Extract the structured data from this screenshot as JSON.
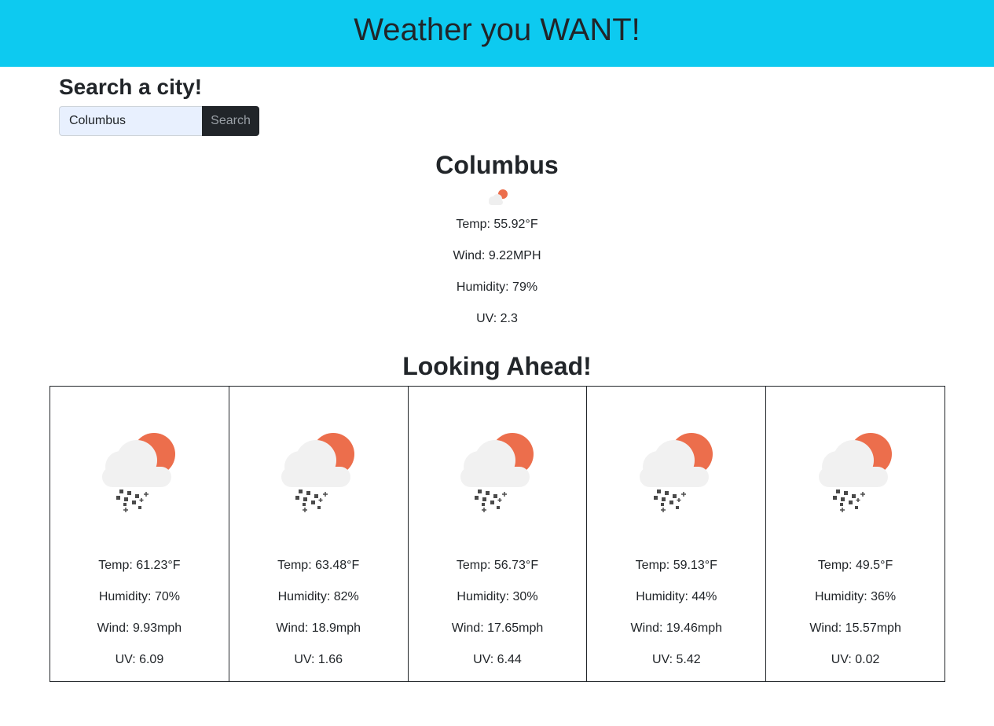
{
  "header": {
    "title": "Weather you WANT!"
  },
  "search": {
    "heading": "Search a city!",
    "input_value": "Columbus",
    "button_label": "Search"
  },
  "current": {
    "city": "Columbus",
    "icon": "cloud-sun-icon",
    "temp": "Temp: 55.92°F",
    "wind": "Wind: 9.22MPH",
    "humidity": "Humidity: 79%",
    "uv": "UV: 2.3"
  },
  "forecast": {
    "heading": "Looking Ahead!",
    "days": [
      {
        "icon": "sleet-icon",
        "temp": "Temp: 61.23°F",
        "humidity": "Humidity: 70%",
        "wind": "Wind: 9.93mph",
        "uv": "UV: 6.09"
      },
      {
        "icon": "sleet-icon",
        "temp": "Temp: 63.48°F",
        "humidity": "Humidity: 82%",
        "wind": "Wind: 18.9mph",
        "uv": "UV: 1.66"
      },
      {
        "icon": "sleet-icon",
        "temp": "Temp: 56.73°F",
        "humidity": "Humidity: 30%",
        "wind": "Wind: 17.65mph",
        "uv": "UV: 6.44"
      },
      {
        "icon": "sleet-icon",
        "temp": "Temp: 59.13°F",
        "humidity": "Humidity: 44%",
        "wind": "Wind: 19.46mph",
        "uv": "UV: 5.42"
      },
      {
        "icon": "sleet-icon",
        "temp": "Temp: 49.5°F",
        "humidity": "Humidity: 36%",
        "wind": "Wind: 15.57mph",
        "uv": "UV: 0.02"
      }
    ]
  },
  "colors": {
    "header_bg": "#0dcaf0",
    "sun": "#ec6e4c",
    "cloud": "#f1f1f1",
    "button_bg": "#212529",
    "input_bg": "#e8f0fe"
  }
}
